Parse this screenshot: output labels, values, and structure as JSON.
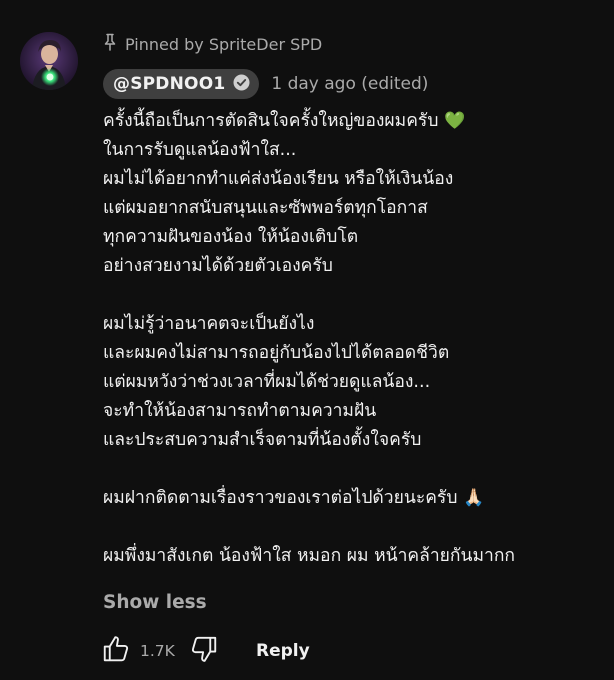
{
  "pinned_label": "Pinned by SpriteDer SPD",
  "author": {
    "handle": "@SPDNOO1",
    "verified": true
  },
  "timestamp": "1 day ago (edited)",
  "comment_lines": [
    "ครั้งนี้ถือเป็นการตัดสินใจครั้งใหญ่ของผมครับ",
    "ในการรับดูแลน้องฟ้าใส...",
    "ผมไม่ได้อยากทำแค่ส่งน้องเรียน หรือให้เงินน้อง",
    "แต่ผมอยากสนับสนุนและซัพพอร์ตทุกโอกาส",
    "ทุกความฝันของน้อง ให้น้องเติบโต",
    "อย่างสวยงามได้ด้วยตัวเองครับ",
    "",
    "ผมไม่รู้ว่าอนาคตจะเป็นยังไง",
    "และผมคงไม่สามารถอยู่กับน้องไปได้ตลอดชีวิต",
    "แต่ผมหวังว่าช่วงเวลาที่ผมได้ช่วยดูแลน้อง...",
    "จะทำให้น้องสามารถทำตามความฝัน",
    "และประสบความสำเร็จตามที่น้องตั้งใจครับ",
    "",
    "ผมฝากติดตามเรื่องราวของเราต่อไปด้วยนะครับ",
    "",
    "ผมพึ่งมาสังเกต น้องฟ้าใส หมอก ผม หน้าคล้ายกันมากก"
  ],
  "emojis": {
    "green_heart": "💚",
    "folded_hands": "🙏🏻"
  },
  "show_less_label": "Show less",
  "like_count": "1.7K",
  "reply_label": "Reply",
  "colors": {
    "background": "#0f0f0f",
    "primary_text": "#f1f1f1",
    "secondary_text": "#aaaaaa",
    "badge_bg": "#3f3f3f",
    "avatar_accent": "#39e07a"
  },
  "icons": {
    "pin": "pin-icon",
    "verified": "verified-check-icon",
    "like": "thumbs-up-icon",
    "dislike": "thumbs-down-icon"
  }
}
